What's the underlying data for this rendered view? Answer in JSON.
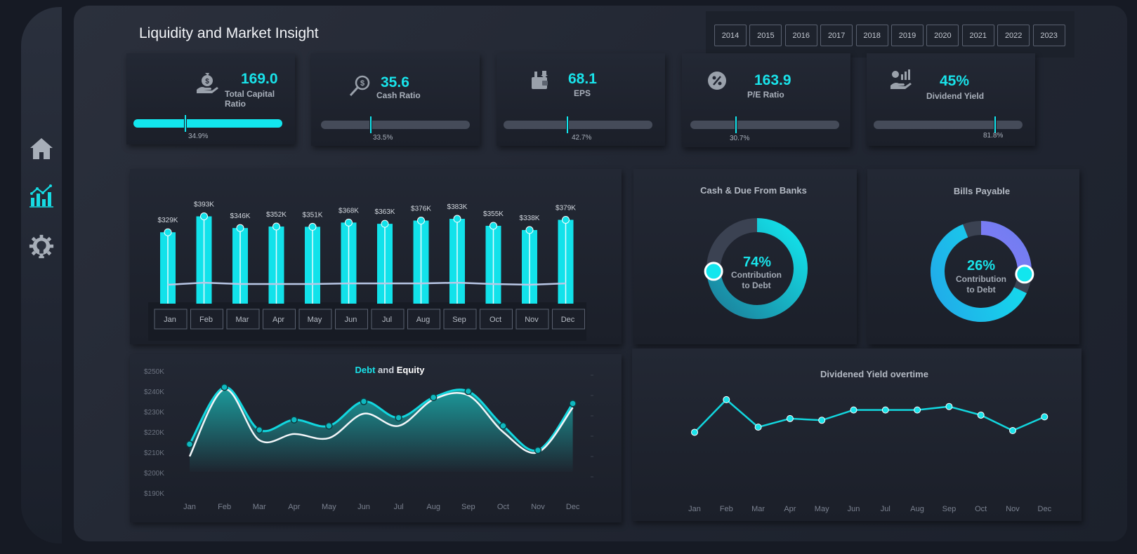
{
  "app": {
    "title": "Liquidity and Market Insight"
  },
  "sidebar": {
    "items": [
      {
        "icon": "home-icon"
      },
      {
        "icon": "analytics-chart-icon"
      },
      {
        "icon": "gear-bulb-icon"
      }
    ]
  },
  "years": [
    "2014",
    "2015",
    "2016",
    "2017",
    "2018",
    "2019",
    "2020",
    "2021",
    "2022",
    "2023"
  ],
  "kpis": [
    {
      "value": "169.0",
      "label": "Total Capital Ratio",
      "pct": "34.9%",
      "level": 34.9,
      "filled": true,
      "icon": "money-hand-icon"
    },
    {
      "value": "35.6",
      "label": "Cash Ratio",
      "pct": "33.5%",
      "level": 33.5,
      "filled": false,
      "icon": "dollar-search-icon"
    },
    {
      "value": "68.1",
      "label": "EPS",
      "pct": "42.7%",
      "level": 42.7,
      "filled": false,
      "icon": "wallet-icon"
    },
    {
      "value": "163.9",
      "label": "P/E Ratio",
      "pct": "30.7%",
      "level": 30.7,
      "filled": false,
      "icon": "price-tag-icon"
    },
    {
      "value": "45%",
      "label": "Dividend Yield",
      "pct": "81.8%",
      "level": 81.8,
      "filled": false,
      "icon": "dividend-hand-icon"
    }
  ],
  "donuts": [
    {
      "title": "Cash & Due From Banks",
      "pct": "74%",
      "sub1": "Contribution",
      "sub2": "to Debt",
      "value": 74
    },
    {
      "title": "Bills Payable",
      "pct": "26%",
      "sub1": "Contribution",
      "sub2": "to Debt",
      "value": 26
    }
  ],
  "colors": {
    "accent": "#12e6ee",
    "panel": "#1b1f29",
    "track": "#454b59"
  },
  "chart_data": [
    {
      "type": "bar",
      "categories": [
        "Jan",
        "Feb",
        "Mar",
        "Apr",
        "May",
        "Jun",
        "Jul",
        "Aug",
        "Sep",
        "Oct",
        "Nov",
        "Dec"
      ],
      "values": [
        329,
        393,
        346,
        352,
        351,
        368,
        363,
        376,
        383,
        355,
        338,
        379
      ],
      "labels": [
        "$329K",
        "$393K",
        "$346K",
        "$352K",
        "$351K",
        "$368K",
        "$363K",
        "$376K",
        "$383K",
        "$355K",
        "$338K",
        "$379K"
      ],
      "line_values": [
        60,
        63,
        61,
        61,
        61,
        62,
        62,
        62,
        63,
        61,
        60,
        62
      ]
    },
    {
      "type": "area",
      "title_part1": "Debt",
      "title_part2": " and ",
      "title_part3": "Equity",
      "categories": [
        "Jan",
        "Feb",
        "Mar",
        "Apr",
        "May",
        "Jun",
        "Jul",
        "Aug",
        "Sep",
        "Oct",
        "Nov",
        "Dec"
      ],
      "yticks": [
        "$250K",
        "$240K",
        "$230K",
        "$220K",
        "$210K",
        "$200K",
        "$190K"
      ],
      "ylim": [
        190,
        250
      ],
      "series": [
        {
          "values": [
            214,
            242,
            221,
            226,
            223,
            235,
            227,
            237,
            240,
            223,
            211,
            234
          ]
        },
        {
          "values": [
            208,
            241,
            216,
            219,
            217,
            229,
            223,
            236,
            238,
            220,
            210,
            232
          ]
        }
      ]
    },
    {
      "type": "line",
      "title": "Dividened Yield overtime",
      "categories": [
        "Jan",
        "Feb",
        "Mar",
        "Apr",
        "May",
        "Jun",
        "Jul",
        "Aug",
        "Sep",
        "Oct",
        "Nov",
        "Dec"
      ],
      "values": [
        39,
        58,
        42,
        47,
        46,
        52,
        52,
        52,
        54,
        49,
        40,
        48
      ],
      "ylim": [
        0,
        100
      ]
    }
  ]
}
